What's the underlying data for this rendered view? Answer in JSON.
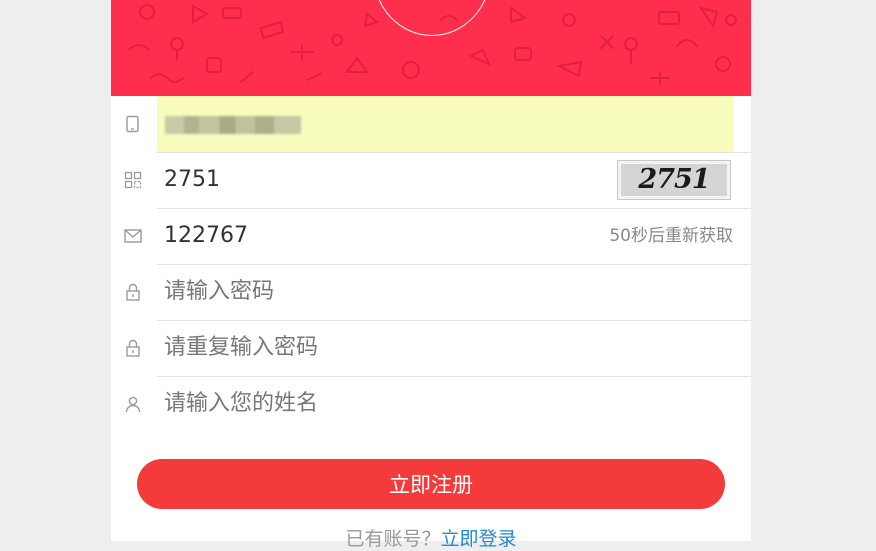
{
  "form": {
    "phone": {
      "value": "",
      "placeholder": ""
    },
    "captcha": {
      "value": "2751",
      "image_text": "2751"
    },
    "sms_code": {
      "value": "122767",
      "resend_label": "50秒后重新获取"
    },
    "password": {
      "placeholder": "请输入密码"
    },
    "password_repeat": {
      "placeholder": "请重复输入密码"
    },
    "name": {
      "placeholder": "请输入您的姓名"
    },
    "submit_label": "立即注册"
  },
  "footer": {
    "prompt": "已有账号？",
    "login_link": "立即登录"
  },
  "colors": {
    "header": "#ff2e4c",
    "button": "#f43a3a",
    "autofill": "#f7fbbc",
    "link": "#1e8ad6"
  },
  "icons": [
    "phone-icon",
    "captcha-icon",
    "mail-icon",
    "lock-icon",
    "lock-icon",
    "user-icon"
  ]
}
